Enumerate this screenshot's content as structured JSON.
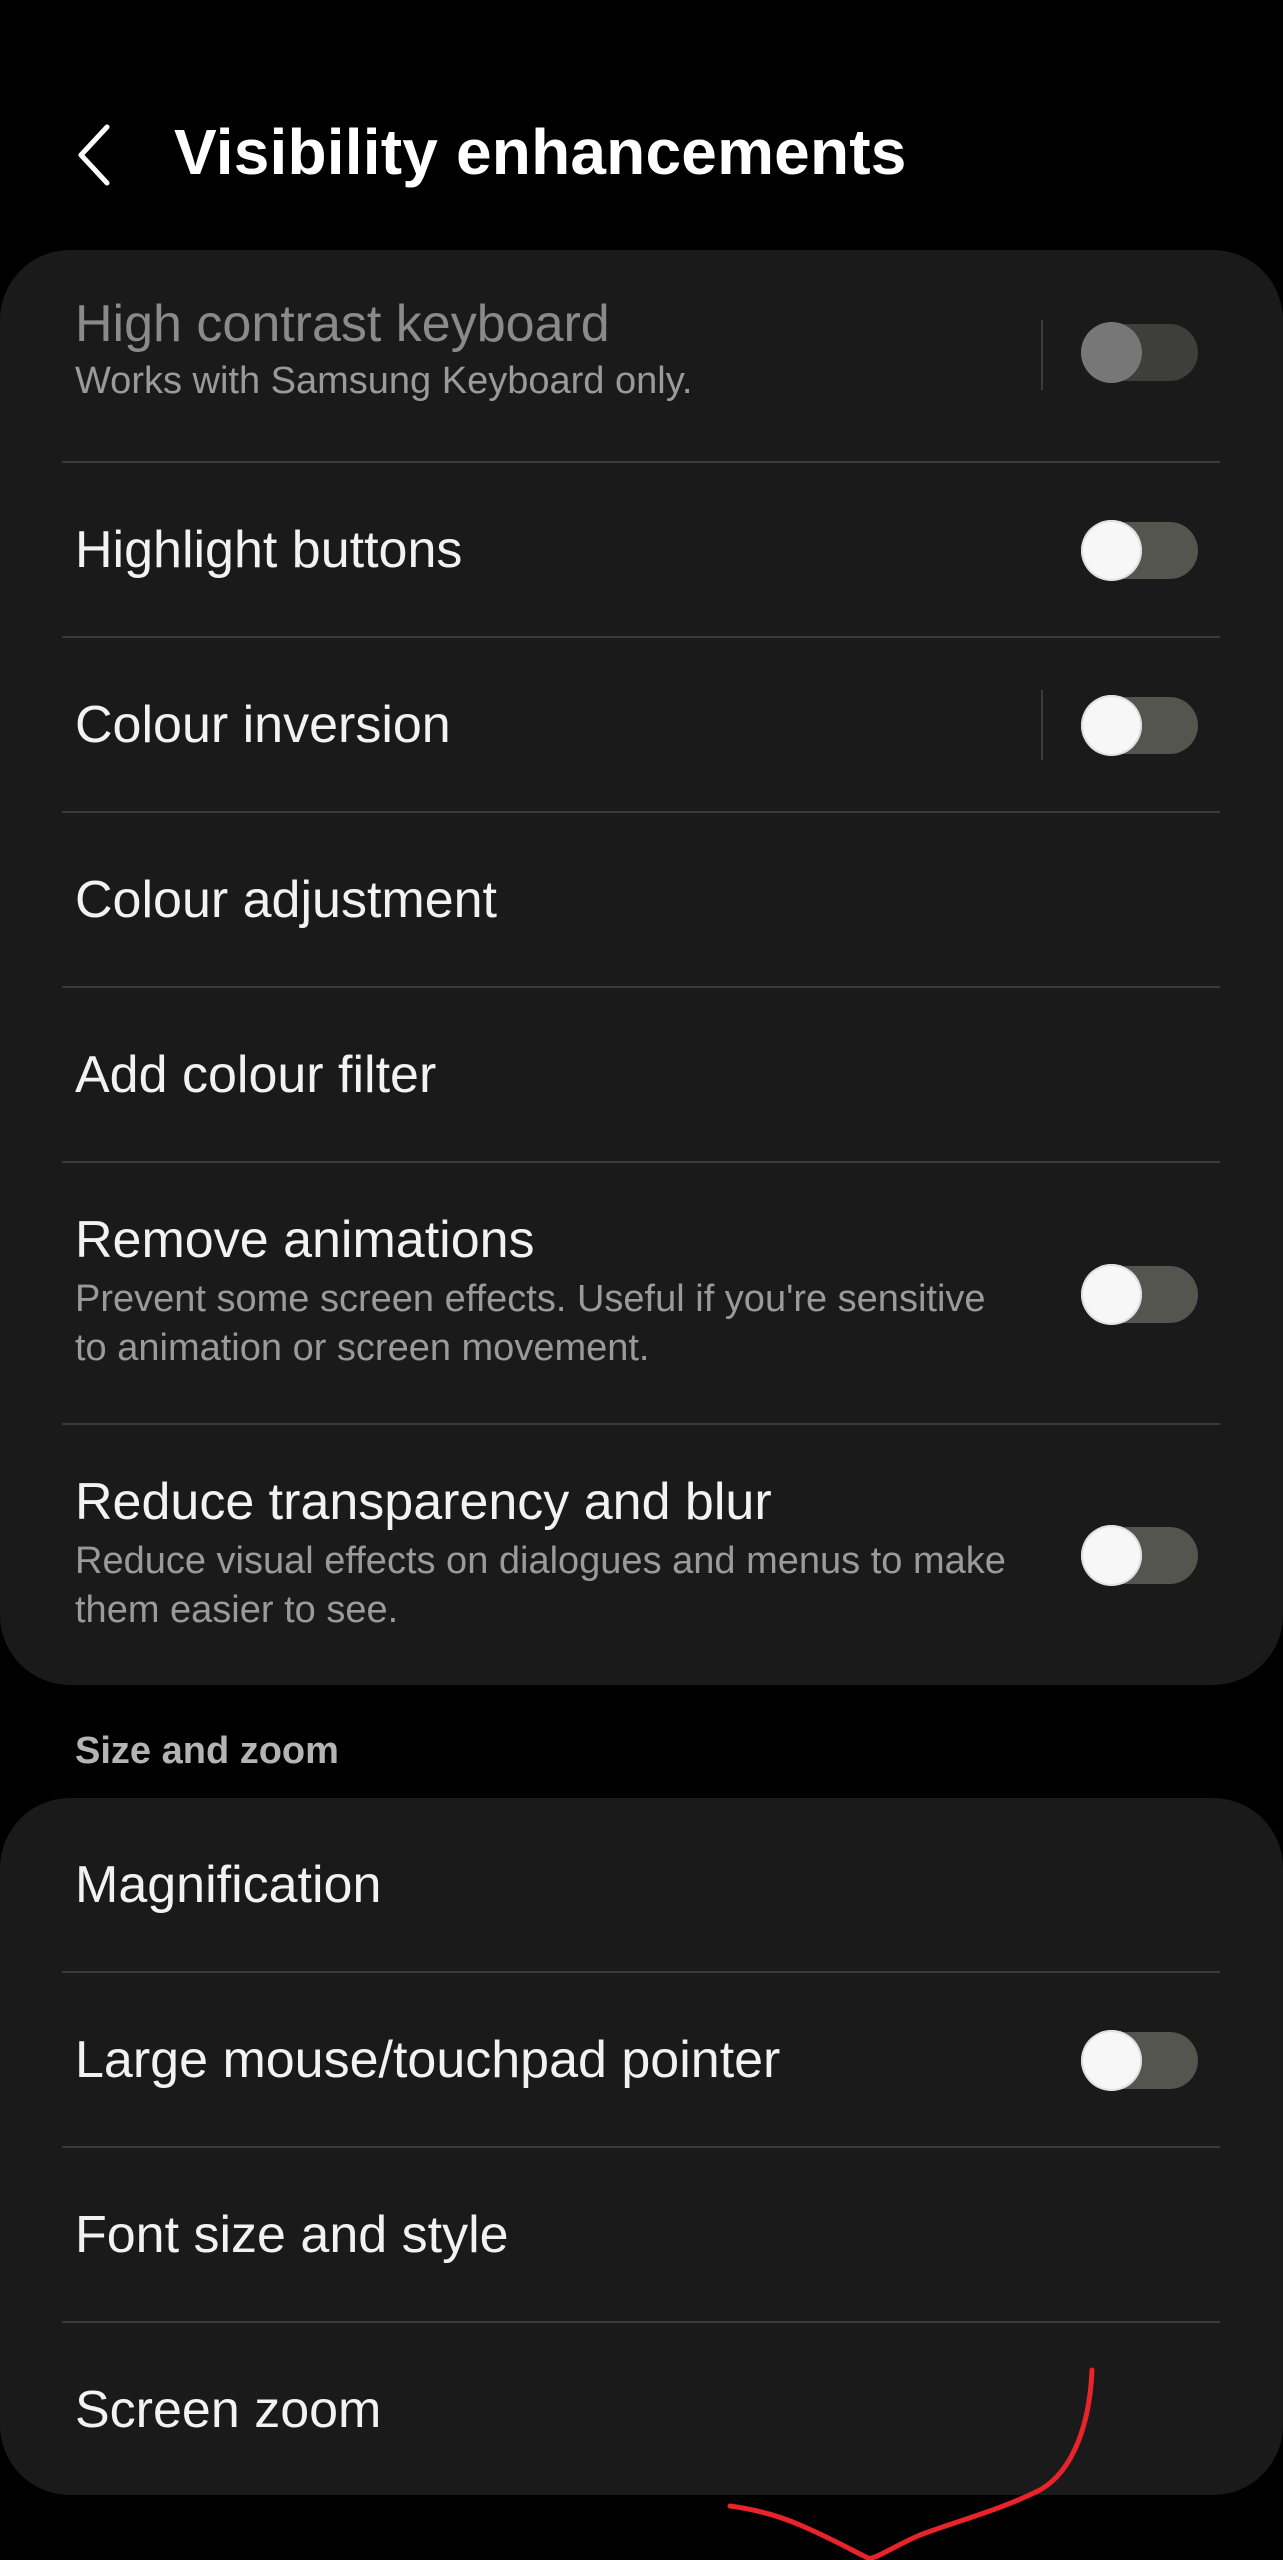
{
  "header": {
    "back_icon": "chevron-left-icon",
    "title": "Visibility enhancements"
  },
  "visibility_items": [
    {
      "title": "High contrast keyboard",
      "subtitle": "Works with Samsung Keyboard only.",
      "toggle": "off",
      "enabled": false
    },
    {
      "title": "Highlight buttons",
      "toggle": "off"
    },
    {
      "title": "Colour inversion",
      "toggle": "off"
    },
    {
      "title": "Colour adjustment"
    },
    {
      "title": "Add colour filter"
    },
    {
      "title": "Remove animations",
      "subtitle": "Prevent some screen effects. Useful if you're sensitive to animation or screen movement.",
      "toggle": "off"
    },
    {
      "title": "Reduce transparency and blur",
      "subtitle": "Reduce visual effects on dialogues and menus to make them easier to see.",
      "toggle": "off"
    }
  ],
  "size_zoom": {
    "label": "Size and zoom",
    "items": [
      {
        "title": "Magnification"
      },
      {
        "title": "Large mouse/touchpad pointer",
        "toggle": "off"
      },
      {
        "title": "Font size and style"
      },
      {
        "title": "Screen zoom"
      }
    ]
  },
  "colors": {
    "background": "#000000",
    "card": "#1a1a1a",
    "toggle_track": "#55554f",
    "annotation_stroke": "#e8232a"
  }
}
